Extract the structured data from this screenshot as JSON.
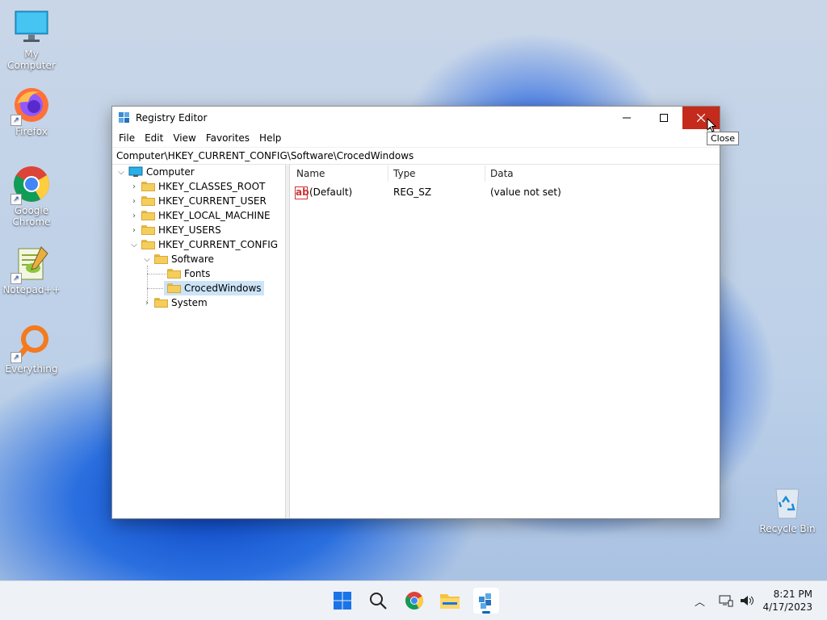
{
  "desktop": {
    "icons": [
      {
        "label": "My Computer"
      },
      {
        "label": "Firefox"
      },
      {
        "label": "Google Chrome"
      },
      {
        "label": "Notepad++"
      },
      {
        "label": "Everything"
      },
      {
        "label": "Recycle Bin"
      }
    ]
  },
  "window": {
    "title": "Registry Editor",
    "close_tooltip": "Close",
    "menu": [
      "File",
      "Edit",
      "View",
      "Favorites",
      "Help"
    ],
    "address": "Computer\\HKEY_CURRENT_CONFIG\\Software\\CrocedWindows",
    "tree": [
      {
        "label": "Computer",
        "expanded": true
      },
      {
        "label": "HKEY_CLASSES_ROOT"
      },
      {
        "label": "HKEY_CURRENT_USER"
      },
      {
        "label": "HKEY_LOCAL_MACHINE"
      },
      {
        "label": "HKEY_USERS"
      },
      {
        "label": "HKEY_CURRENT_CONFIG",
        "expanded": true
      },
      {
        "label": "Software",
        "expanded": true
      },
      {
        "label": "Fonts"
      },
      {
        "label": "CrocedWindows",
        "selected": true
      },
      {
        "label": "System"
      }
    ],
    "columns": [
      "Name",
      "Type",
      "Data"
    ],
    "rows": [
      {
        "name": "(Default)",
        "type": "REG_SZ",
        "data": "(value not set)"
      }
    ]
  },
  "taskbar": {
    "apps": [
      "start-icon",
      "search-icon",
      "chrome-icon",
      "file-explorer-icon",
      "registry-editor-icon"
    ],
    "clock_time": "8:21 PM",
    "clock_date": "4/17/2023"
  },
  "colors": {
    "close_button": "#c42b1c",
    "selection": "#cce4f7",
    "accent": "#0067c0"
  }
}
